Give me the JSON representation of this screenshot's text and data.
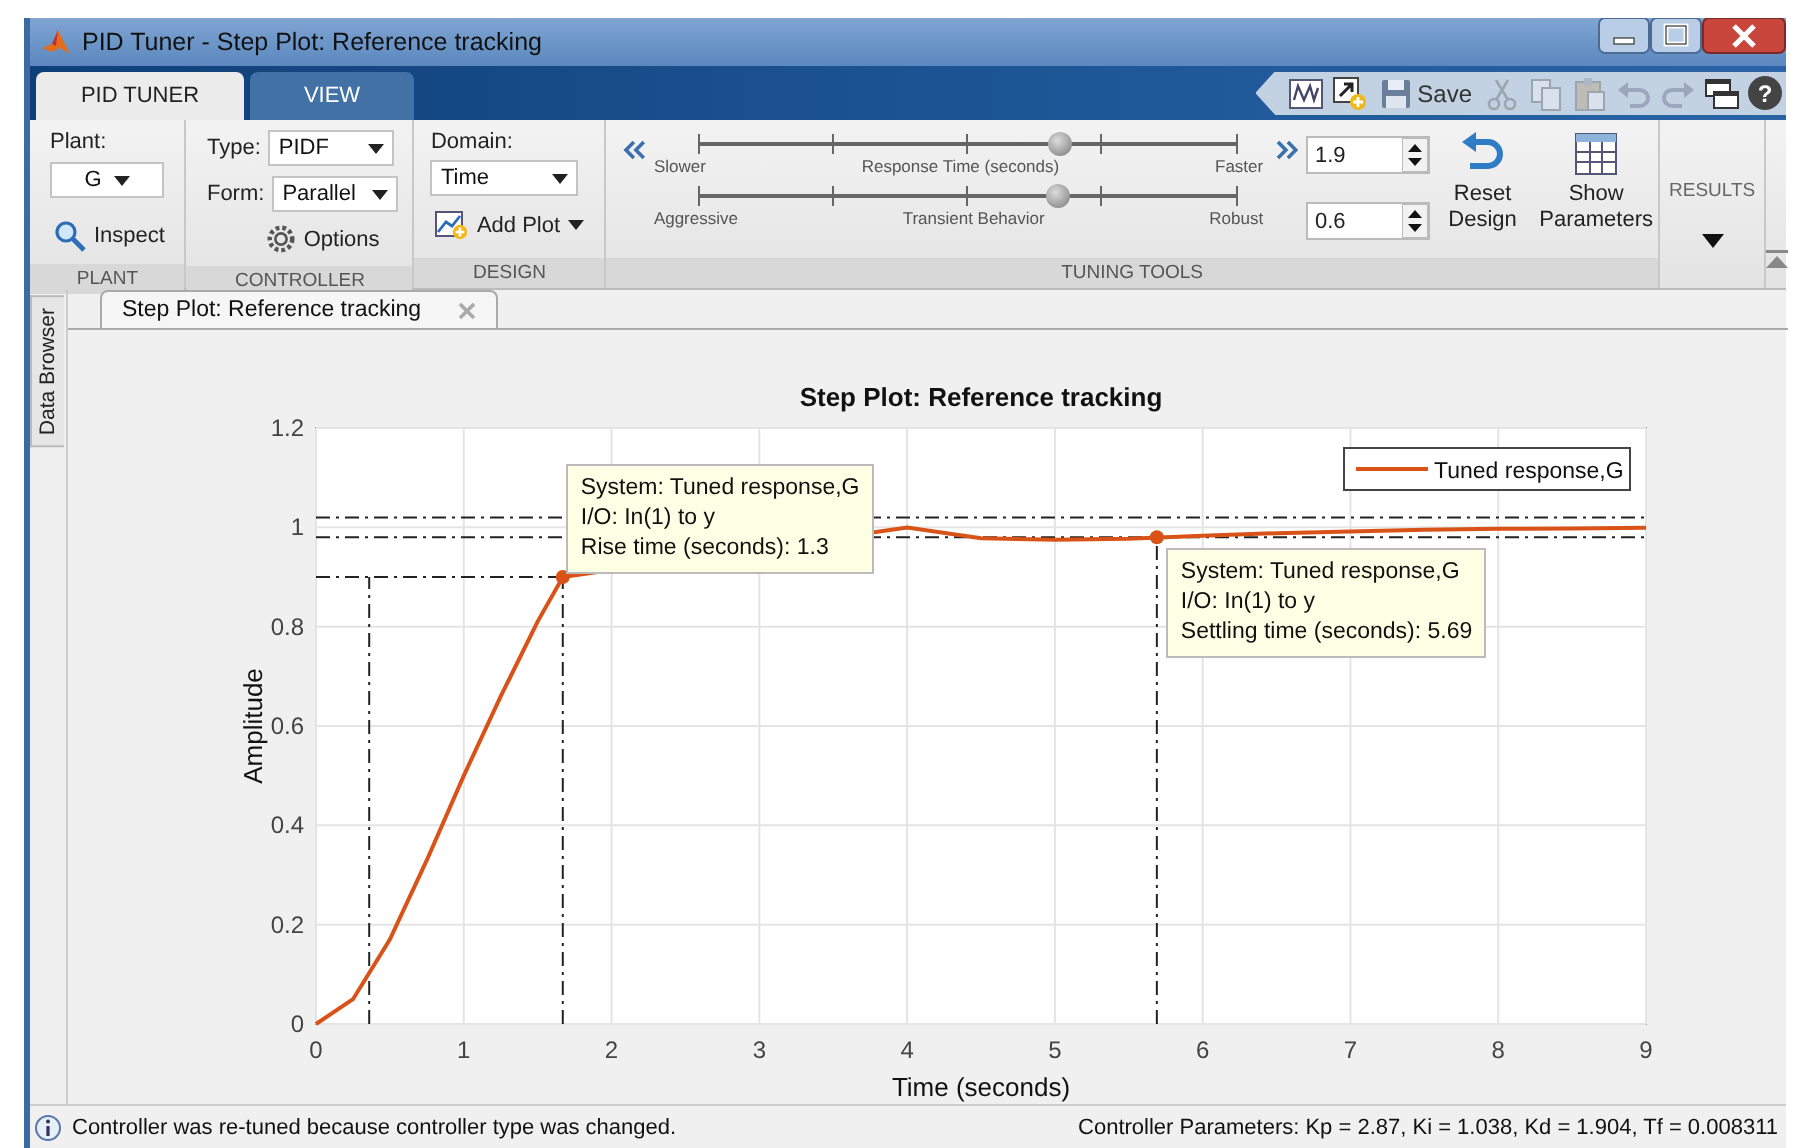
{
  "window": {
    "title": "PID Tuner - Step Plot: Reference tracking"
  },
  "ribbon_tabs": [
    {
      "label": "PID TUNER",
      "selected": true
    },
    {
      "label": "VIEW",
      "selected": false
    }
  ],
  "quick_access": [
    {
      "kind": "plot",
      "disabled": false
    },
    {
      "kind": "export",
      "disabled": false
    },
    {
      "kind": "save",
      "label": "Save",
      "disabled": false
    },
    {
      "kind": "cut",
      "disabled": true
    },
    {
      "kind": "copy",
      "disabled": true
    },
    {
      "kind": "paste",
      "disabled": true
    },
    {
      "kind": "undo",
      "disabled": true
    },
    {
      "kind": "redo",
      "disabled": true
    },
    {
      "kind": "layout",
      "disabled": false
    },
    {
      "kind": "help",
      "label": "?",
      "disabled": false
    }
  ],
  "plant": {
    "label": "Plant:",
    "value": "G",
    "inspect": "Inspect",
    "footer": "PLANT"
  },
  "controller": {
    "type_label": "Type:",
    "type": "PIDF",
    "form_label": "Form:",
    "form": "Parallel",
    "options": "Options",
    "footer": "CONTROLLER"
  },
  "design": {
    "domain_label": "Domain:",
    "domain": "Time",
    "add_plot": "Add Plot",
    "footer": "DESIGN"
  },
  "tuning": {
    "sliders": [
      {
        "left": "Slower",
        "center": "Response Time (seconds)",
        "right": "Faster",
        "level": 0.675,
        "value": "1.9"
      },
      {
        "left": "Aggressive",
        "center": "Transient Behavior",
        "right": "Robust",
        "level": 0.67,
        "value": "0.6"
      }
    ],
    "reset": "Reset Design",
    "show": "Show Parameters",
    "footer": "TUNING TOOLS"
  },
  "results": {
    "label": "RESULTS"
  },
  "side_tab": "Data Browser",
  "document_tab": {
    "label": "Step Plot: Reference tracking"
  },
  "plot": {
    "chart_data": {
      "type": "line",
      "title": "Step Plot: Reference tracking",
      "xlabel": "Time (seconds)",
      "ylabel": "Amplitude",
      "x": [
        0,
        0.25,
        0.5,
        0.75,
        1,
        1.25,
        1.5,
        1.67,
        4,
        4.5,
        5,
        5.5,
        6,
        6.5,
        7,
        7.5,
        8,
        8.5,
        9
      ],
      "series": [
        {
          "name": "Tuned response,G",
          "color": "#d95319",
          "values": [
            0,
            0.05,
            0.17,
            0.33,
            0.5,
            0.66,
            0.81,
            0.9,
            1.0,
            0.978,
            0.975,
            0.977,
            0.983,
            0.988,
            0.992,
            0.995,
            0.997,
            0.998,
            0.999
          ]
        }
      ],
      "xlim": [
        0,
        9
      ],
      "ylim": [
        0,
        1.2
      ],
      "xticks": [
        0,
        1,
        2,
        3,
        4,
        5,
        6,
        7,
        8,
        9
      ],
      "yticks": [
        0,
        0.2,
        0.4,
        0.6,
        0.8,
        1,
        1.2
      ],
      "grid": true,
      "ref_lines": [
        {
          "axis": "y",
          "value": 1.02
        },
        {
          "axis": "y",
          "value": 0.98
        },
        {
          "axis": "y",
          "value": 0.9
        },
        {
          "axis": "x",
          "value": 0.36
        },
        {
          "axis": "x",
          "value": 1.67
        },
        {
          "axis": "x",
          "value": 5.69
        }
      ],
      "annotations": [
        {
          "text": "System: Tuned response,G\nI/O: In(1) to y\nRise time (seconds): 1.3",
          "x": 1.67,
          "y": 0.9
        },
        {
          "text": "System: Tuned response,G\nI/O: In(1) to y\nSettling time (seconds): 5.69",
          "x": 5.69,
          "y": 0.98
        }
      ]
    }
  },
  "status_bar": {
    "message": "Controller was re-tuned because controller type was changed.",
    "parameters": "Controller Parameters: Kp = 2.87, Ki = 1.038, Kd = 1.904, Tf = 0.008311"
  }
}
